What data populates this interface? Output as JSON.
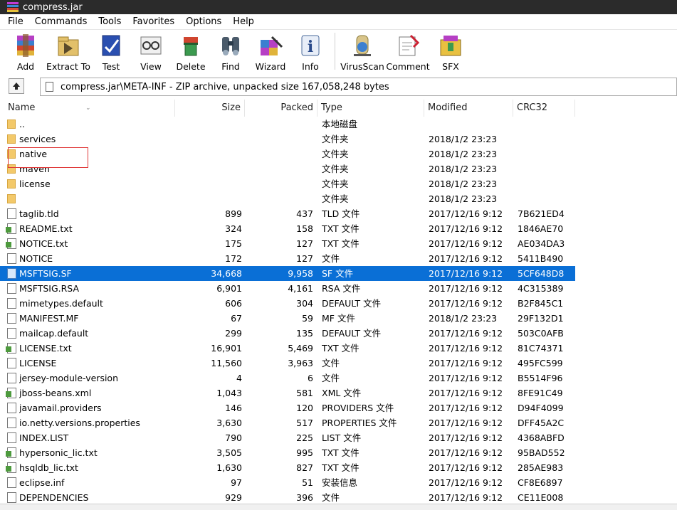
{
  "window": {
    "title": "compress.jar"
  },
  "menu": [
    "File",
    "Commands",
    "Tools",
    "Favorites",
    "Options",
    "Help"
  ],
  "toolbar": {
    "buttons": [
      {
        "label": "Add",
        "icon": "add-icon"
      },
      {
        "label": "Extract To",
        "icon": "extract-icon"
      },
      {
        "label": "Test",
        "icon": "test-icon"
      },
      {
        "label": "View",
        "icon": "view-icon"
      },
      {
        "label": "Delete",
        "icon": "delete-icon"
      },
      {
        "label": "Find",
        "icon": "find-icon"
      },
      {
        "label": "Wizard",
        "icon": "wizard-icon"
      },
      {
        "label": "Info",
        "icon": "info-icon"
      }
    ],
    "buttons2": [
      {
        "label": "VirusScan",
        "icon": "virusscan-icon"
      },
      {
        "label": "Comment",
        "icon": "comment-icon"
      },
      {
        "label": "SFX",
        "icon": "sfx-icon"
      }
    ]
  },
  "address": {
    "path": "compress.jar\\META-INF - ZIP archive, unpacked size 167,058,248 bytes"
  },
  "columns": {
    "name": "Name",
    "size": "Size",
    "packed": "Packed",
    "type": "Type",
    "modified": "Modified",
    "crc": "CRC32"
  },
  "files": [
    {
      "name": "..",
      "size": "",
      "packed": "",
      "type": "本地磁盘",
      "modified": "",
      "crc": "",
      "icon": "folder"
    },
    {
      "name": "services",
      "size": "",
      "packed": "",
      "type": "文件夹",
      "modified": "2018/1/2 23:23",
      "crc": "",
      "icon": "folder"
    },
    {
      "name": "native",
      "size": "",
      "packed": "",
      "type": "文件夹",
      "modified": "2018/1/2 23:23",
      "crc": "",
      "icon": "folder"
    },
    {
      "name": "maven",
      "size": "",
      "packed": "",
      "type": "文件夹",
      "modified": "2018/1/2 23:23",
      "crc": "",
      "icon": "folder"
    },
    {
      "name": "license",
      "size": "",
      "packed": "",
      "type": "文件夹",
      "modified": "2018/1/2 23:23",
      "crc": "",
      "icon": "folder"
    },
    {
      "name": "",
      "size": "",
      "packed": "",
      "type": "文件夹",
      "modified": "2018/1/2 23:23",
      "crc": "",
      "icon": "folder"
    },
    {
      "name": "taglib.tld",
      "size": "899",
      "packed": "437",
      "type": "TLD 文件",
      "modified": "2017/12/16 9:12",
      "crc": "7B621ED4",
      "icon": "file"
    },
    {
      "name": "README.txt",
      "size": "324",
      "packed": "158",
      "type": "TXT 文件",
      "modified": "2017/12/16 9:12",
      "crc": "1846AE70",
      "icon": "txt"
    },
    {
      "name": "NOTICE.txt",
      "size": "175",
      "packed": "127",
      "type": "TXT 文件",
      "modified": "2017/12/16 9:12",
      "crc": "AE034DA3",
      "icon": "txt"
    },
    {
      "name": "NOTICE",
      "size": "172",
      "packed": "127",
      "type": "文件",
      "modified": "2017/12/16 9:12",
      "crc": "5411B490",
      "icon": "file"
    },
    {
      "name": "MSFTSIG.SF",
      "size": "34,668",
      "packed": "9,958",
      "type": "SF 文件",
      "modified": "2017/12/16 9:12",
      "crc": "5CF648D8",
      "icon": "blue",
      "selected": true
    },
    {
      "name": "MSFTSIG.RSA",
      "size": "6,901",
      "packed": "4,161",
      "type": "RSA 文件",
      "modified": "2017/12/16 9:12",
      "crc": "4C315389",
      "icon": "file"
    },
    {
      "name": "mimetypes.default",
      "size": "606",
      "packed": "304",
      "type": "DEFAULT 文件",
      "modified": "2017/12/16 9:12",
      "crc": "B2F845C1",
      "icon": "file"
    },
    {
      "name": "MANIFEST.MF",
      "size": "67",
      "packed": "59",
      "type": "MF 文件",
      "modified": "2018/1/2 23:23",
      "crc": "29F132D1",
      "icon": "file"
    },
    {
      "name": "mailcap.default",
      "size": "299",
      "packed": "135",
      "type": "DEFAULT 文件",
      "modified": "2017/12/16 9:12",
      "crc": "503C0AFB",
      "icon": "file"
    },
    {
      "name": "LICENSE.txt",
      "size": "16,901",
      "packed": "5,469",
      "type": "TXT 文件",
      "modified": "2017/12/16 9:12",
      "crc": "81C74371",
      "icon": "txt"
    },
    {
      "name": "LICENSE",
      "size": "11,560",
      "packed": "3,963",
      "type": "文件",
      "modified": "2017/12/16 9:12",
      "crc": "495FC599",
      "icon": "file"
    },
    {
      "name": "jersey-module-version",
      "size": "4",
      "packed": "6",
      "type": "文件",
      "modified": "2017/12/16 9:12",
      "crc": "B5514F96",
      "icon": "file"
    },
    {
      "name": "jboss-beans.xml",
      "size": "1,043",
      "packed": "581",
      "type": "XML 文件",
      "modified": "2017/12/16 9:12",
      "crc": "8FE91C49",
      "icon": "txt"
    },
    {
      "name": "javamail.providers",
      "size": "146",
      "packed": "120",
      "type": "PROVIDERS 文件",
      "modified": "2017/12/16 9:12",
      "crc": "D94F4099",
      "icon": "file"
    },
    {
      "name": "io.netty.versions.properties",
      "size": "3,630",
      "packed": "517",
      "type": "PROPERTIES 文件",
      "modified": "2017/12/16 9:12",
      "crc": "DFF45A2C",
      "icon": "file"
    },
    {
      "name": "INDEX.LIST",
      "size": "790",
      "packed": "225",
      "type": "LIST 文件",
      "modified": "2017/12/16 9:12",
      "crc": "4368ABFD",
      "icon": "file"
    },
    {
      "name": "hypersonic_lic.txt",
      "size": "3,505",
      "packed": "995",
      "type": "TXT 文件",
      "modified": "2017/12/16 9:12",
      "crc": "95BAD552",
      "icon": "txt"
    },
    {
      "name": "hsqldb_lic.txt",
      "size": "1,630",
      "packed": "827",
      "type": "TXT 文件",
      "modified": "2017/12/16 9:12",
      "crc": "285AE983",
      "icon": "txt"
    },
    {
      "name": "eclipse.inf",
      "size": "97",
      "packed": "51",
      "type": "安装信息",
      "modified": "2017/12/16 9:12",
      "crc": "CF8E6897",
      "icon": "file"
    },
    {
      "name": "DEPENDENCIES",
      "size": "929",
      "packed": "396",
      "type": "文件",
      "modified": "2017/12/16 9:12",
      "crc": "CE11E008",
      "icon": "file"
    }
  ],
  "colors": {
    "selection": "#0a6fd6",
    "highlight_box": "#e03a3a"
  }
}
